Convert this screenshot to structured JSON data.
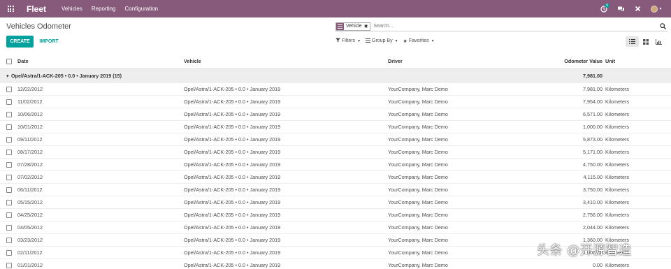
{
  "navbar": {
    "app_name": "Fleet",
    "menu": [
      "Vehicles",
      "Reporting",
      "Configuration"
    ],
    "chat_badge": "6",
    "brand_color": "#875a7b"
  },
  "control_panel": {
    "title": "Vehicles Odometer",
    "search": {
      "facet_value": "Vehicle",
      "placeholder": "Search..."
    },
    "create_label": "CREATE",
    "import_label": "IMPORT",
    "filters_label": "Filters",
    "groupby_label": "Group By",
    "favorites_label": "Favorites",
    "accent_color": "#00a09d"
  },
  "table": {
    "columns": {
      "date": "Date",
      "vehicle": "Vehicle",
      "driver": "Driver",
      "odometer": "Odometer Value",
      "unit": "Unit"
    },
    "group": {
      "label": "Opel/Astra/1-ACK-205 • 0.0 • January 2019 (15)",
      "total": "7,981.00"
    },
    "rows": [
      {
        "date": "12/02/2012",
        "vehicle": "Opel/Astra/1-ACK-205 • 0.0 • January 2019",
        "driver": "YourCompany, Marc Demo",
        "odometer": "7,981.00",
        "unit": "Kilometers"
      },
      {
        "date": "11/02/2012",
        "vehicle": "Opel/Astra/1-ACK-205 • 0.0 • January 2019",
        "driver": "YourCompany, Marc Demo",
        "odometer": "7,954.00",
        "unit": "Kilometers"
      },
      {
        "date": "10/06/2012",
        "vehicle": "Opel/Astra/1-ACK-205 • 0.0 • January 2019",
        "driver": "YourCompany, Marc Demo",
        "odometer": "6,571.00",
        "unit": "Kilometers"
      },
      {
        "date": "10/01/2012",
        "vehicle": "Opel/Astra/1-ACK-205 • 0.0 • January 2019",
        "driver": "YourCompany, Marc Demo",
        "odometer": "1,000.00",
        "unit": "Kilometers"
      },
      {
        "date": "09/11/2012",
        "vehicle": "Opel/Astra/1-ACK-205 • 0.0 • January 2019",
        "driver": "YourCompany, Marc Demo",
        "odometer": "5,873.00",
        "unit": "Kilometers"
      },
      {
        "date": "08/17/2012",
        "vehicle": "Opel/Astra/1-ACK-205 • 0.0 • January 2019",
        "driver": "YourCompany, Marc Demo",
        "odometer": "5,171.00",
        "unit": "Kilometers"
      },
      {
        "date": "07/28/2012",
        "vehicle": "Opel/Astra/1-ACK-205 • 0.0 • January 2019",
        "driver": "YourCompany, Marc Demo",
        "odometer": "4,750.00",
        "unit": "Kilometers"
      },
      {
        "date": "07/02/2012",
        "vehicle": "Opel/Astra/1-ACK-205 • 0.0 • January 2019",
        "driver": "YourCompany, Marc Demo",
        "odometer": "4,115.00",
        "unit": "Kilometers"
      },
      {
        "date": "06/11/2012",
        "vehicle": "Opel/Astra/1-ACK-205 • 0.0 • January 2019",
        "driver": "YourCompany, Marc Demo",
        "odometer": "3,750.00",
        "unit": "Kilometers"
      },
      {
        "date": "05/15/2012",
        "vehicle": "Opel/Astra/1-ACK-205 • 0.0 • January 2019",
        "driver": "YourCompany, Marc Demo",
        "odometer": "3,410.00",
        "unit": "Kilometers"
      },
      {
        "date": "04/25/2012",
        "vehicle": "Opel/Astra/1-ACK-205 • 0.0 • January 2019",
        "driver": "YourCompany, Marc Demo",
        "odometer": "2,756.00",
        "unit": "Kilometers"
      },
      {
        "date": "04/05/2012",
        "vehicle": "Opel/Astra/1-ACK-205 • 0.0 • January 2019",
        "driver": "YourCompany, Marc Demo",
        "odometer": "2,044.00",
        "unit": "Kilometers"
      },
      {
        "date": "03/23/2012",
        "vehicle": "Opel/Astra/1-ACK-205 • 0.0 • January 2019",
        "driver": "YourCompany, Marc Demo",
        "odometer": "1,360.00",
        "unit": "Kilometers"
      },
      {
        "date": "02/11/2012",
        "vehicle": "Opel/Astra/1-ACK-205 • 0.0 • January 2019",
        "driver": "YourCompany, Marc Demo",
        "odometer": "1,000.00",
        "unit": "Kilometers"
      },
      {
        "date": "01/01/2012",
        "vehicle": "Opel/Astra/1-ACK-205 • 0.0 • January 2019",
        "driver": "YourCompany, Marc Demo",
        "odometer": "0.00",
        "unit": "Kilometers"
      }
    ]
  },
  "watermark": "头条 @开源智造",
  "icons": {
    "apps": "apps-grid-icon",
    "activity": "clock-icon",
    "chat": "chat-icon",
    "close": "close-icon",
    "user": "avatar",
    "search": "search-icon",
    "list_view": "list-view-icon",
    "kanban_view": "kanban-view-icon",
    "graph_view": "graph-view-icon"
  }
}
